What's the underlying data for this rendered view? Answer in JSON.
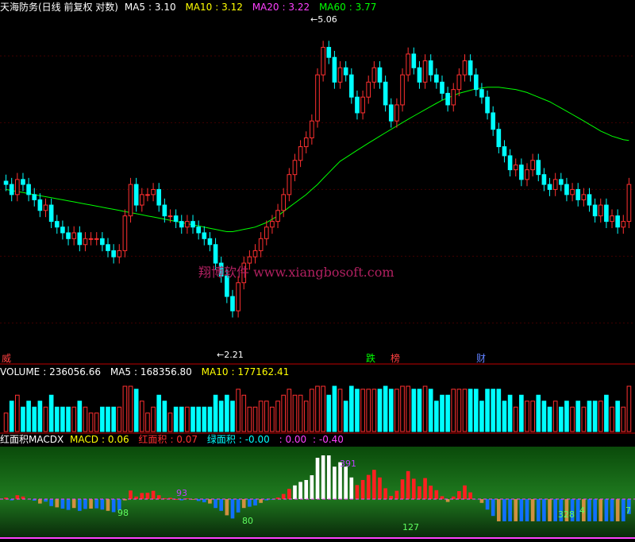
{
  "chart_data": [
    {
      "type": "candlestick",
      "title": "天海防务(日线 前复权 对数)",
      "indicators": [
        {
          "name": "MA5",
          "value": "3.10",
          "color": "#ffffff"
        },
        {
          "name": "MA10",
          "value": "3.12",
          "color": "#ffff00"
        },
        {
          "name": "MA20",
          "value": "3.22",
          "color": "#ff40ff"
        },
        {
          "name": "MA60",
          "value": "3.77",
          "color": "#00ff00"
        }
      ],
      "price_high": 5.06,
      "price_low": 2.21,
      "high_label": "5.06",
      "low_label": "2.21",
      "ylim": [
        2.0,
        5.5
      ],
      "y_scale": "log",
      "grid": true,
      "closes": [
        3.3,
        3.2,
        3.35,
        3.3,
        3.2,
        3.15,
        3.05,
        3.1,
        2.95,
        2.9,
        2.85,
        2.8,
        2.85,
        2.75,
        2.8,
        2.8,
        2.8,
        2.75,
        2.7,
        2.65,
        2.7,
        3.0,
        3.3,
        3.1,
        3.2,
        3.2,
        3.25,
        3.1,
        3.0,
        3.0,
        2.95,
        2.9,
        2.95,
        2.9,
        2.85,
        2.8,
        2.75,
        2.6,
        2.5,
        2.35,
        2.25,
        2.45,
        2.6,
        2.65,
        2.7,
        2.8,
        2.9,
        2.95,
        3.05,
        3.2,
        3.4,
        3.55,
        3.7,
        3.8,
        4.0,
        4.6,
        5.0,
        4.85,
        4.5,
        4.7,
        4.6,
        4.3,
        4.1,
        4.3,
        4.5,
        4.7,
        4.5,
        4.2,
        4.0,
        4.2,
        4.6,
        4.9,
        4.7,
        4.5,
        4.8,
        4.6,
        4.5,
        4.35,
        4.2,
        4.4,
        4.6,
        4.8,
        4.6,
        4.4,
        4.3,
        4.1,
        3.9,
        3.7,
        3.6,
        3.45,
        3.5,
        3.35,
        3.45,
        3.55,
        3.4,
        3.3,
        3.25,
        3.35,
        3.3,
        3.2,
        3.25,
        3.15,
        3.2,
        3.1,
        3.0,
        3.1,
        2.95,
        3.0,
        2.9,
        2.95,
        3.3
      ],
      "ma60": [
        3.25,
        3.24,
        3.23,
        3.22,
        3.21,
        3.2,
        3.19,
        3.18,
        3.17,
        3.16,
        3.15,
        3.14,
        3.13,
        3.12,
        3.11,
        3.1,
        3.09,
        3.08,
        3.07,
        3.06,
        3.05,
        3.04,
        3.03,
        3.02,
        3.01,
        3.0,
        2.99,
        2.98,
        2.97,
        2.96,
        2.95,
        2.94,
        2.93,
        2.92,
        2.91,
        2.9,
        2.89,
        2.88,
        2.87,
        2.86,
        2.86,
        2.87,
        2.88,
        2.89,
        2.9,
        2.92,
        2.94,
        2.97,
        3.0,
        3.04,
        3.08,
        3.12,
        3.16,
        3.2,
        3.25,
        3.3,
        3.36,
        3.42,
        3.48,
        3.54,
        3.58,
        3.62,
        3.66,
        3.7,
        3.74,
        3.78,
        3.82,
        3.86,
        3.9,
        3.94,
        3.98,
        4.02,
        4.06,
        4.1,
        4.14,
        4.18,
        4.22,
        4.26,
        4.29,
        4.32,
        4.35,
        4.37,
        4.39,
        4.41,
        4.42,
        4.43,
        4.43,
        4.43,
        4.42,
        4.41,
        4.4,
        4.38,
        4.36,
        4.33,
        4.3,
        4.27,
        4.24,
        4.2,
        4.16,
        4.12,
        4.08,
        4.04,
        4.0,
        3.96,
        3.92,
        3.88,
        3.85,
        3.82,
        3.8,
        3.78,
        3.77
      ],
      "annotations": [
        {
          "text": "威",
          "color": "#ff4040"
        },
        {
          "text": "跌",
          "color": "#00ff00"
        },
        {
          "text": "榜",
          "color": "#ff4040"
        },
        {
          "text": "财",
          "color": "#6080ff"
        }
      ],
      "watermark": "翔博软件  www.xiangbosoft.com"
    },
    {
      "type": "bar",
      "title": "VOLUME",
      "indicators": [
        {
          "name": "VOLUME",
          "value": "236056.66",
          "color": "#ffffff"
        },
        {
          "name": "MA5",
          "value": "168356.80",
          "color": "#ffffff"
        },
        {
          "name": "MA10",
          "value": "177162.41",
          "color": "#ffff00"
        }
      ]
    },
    {
      "type": "bar",
      "title": "红面积MACDX",
      "indicators": [
        {
          "name": "MACD",
          "value": "0.06",
          "color": "#ffff00"
        },
        {
          "name": "红面积",
          "value": "0.07",
          "color": "#ff3030"
        },
        {
          "name": "绿面积",
          "value": "-0.00",
          "color": "#00ffff"
        }
      ],
      "extra_values": [
        ": 0.00",
        ": -0.40"
      ],
      "labels": [
        "98",
        "93",
        "80",
        "391",
        "127",
        "328",
        "4",
        "7"
      ]
    }
  ]
}
